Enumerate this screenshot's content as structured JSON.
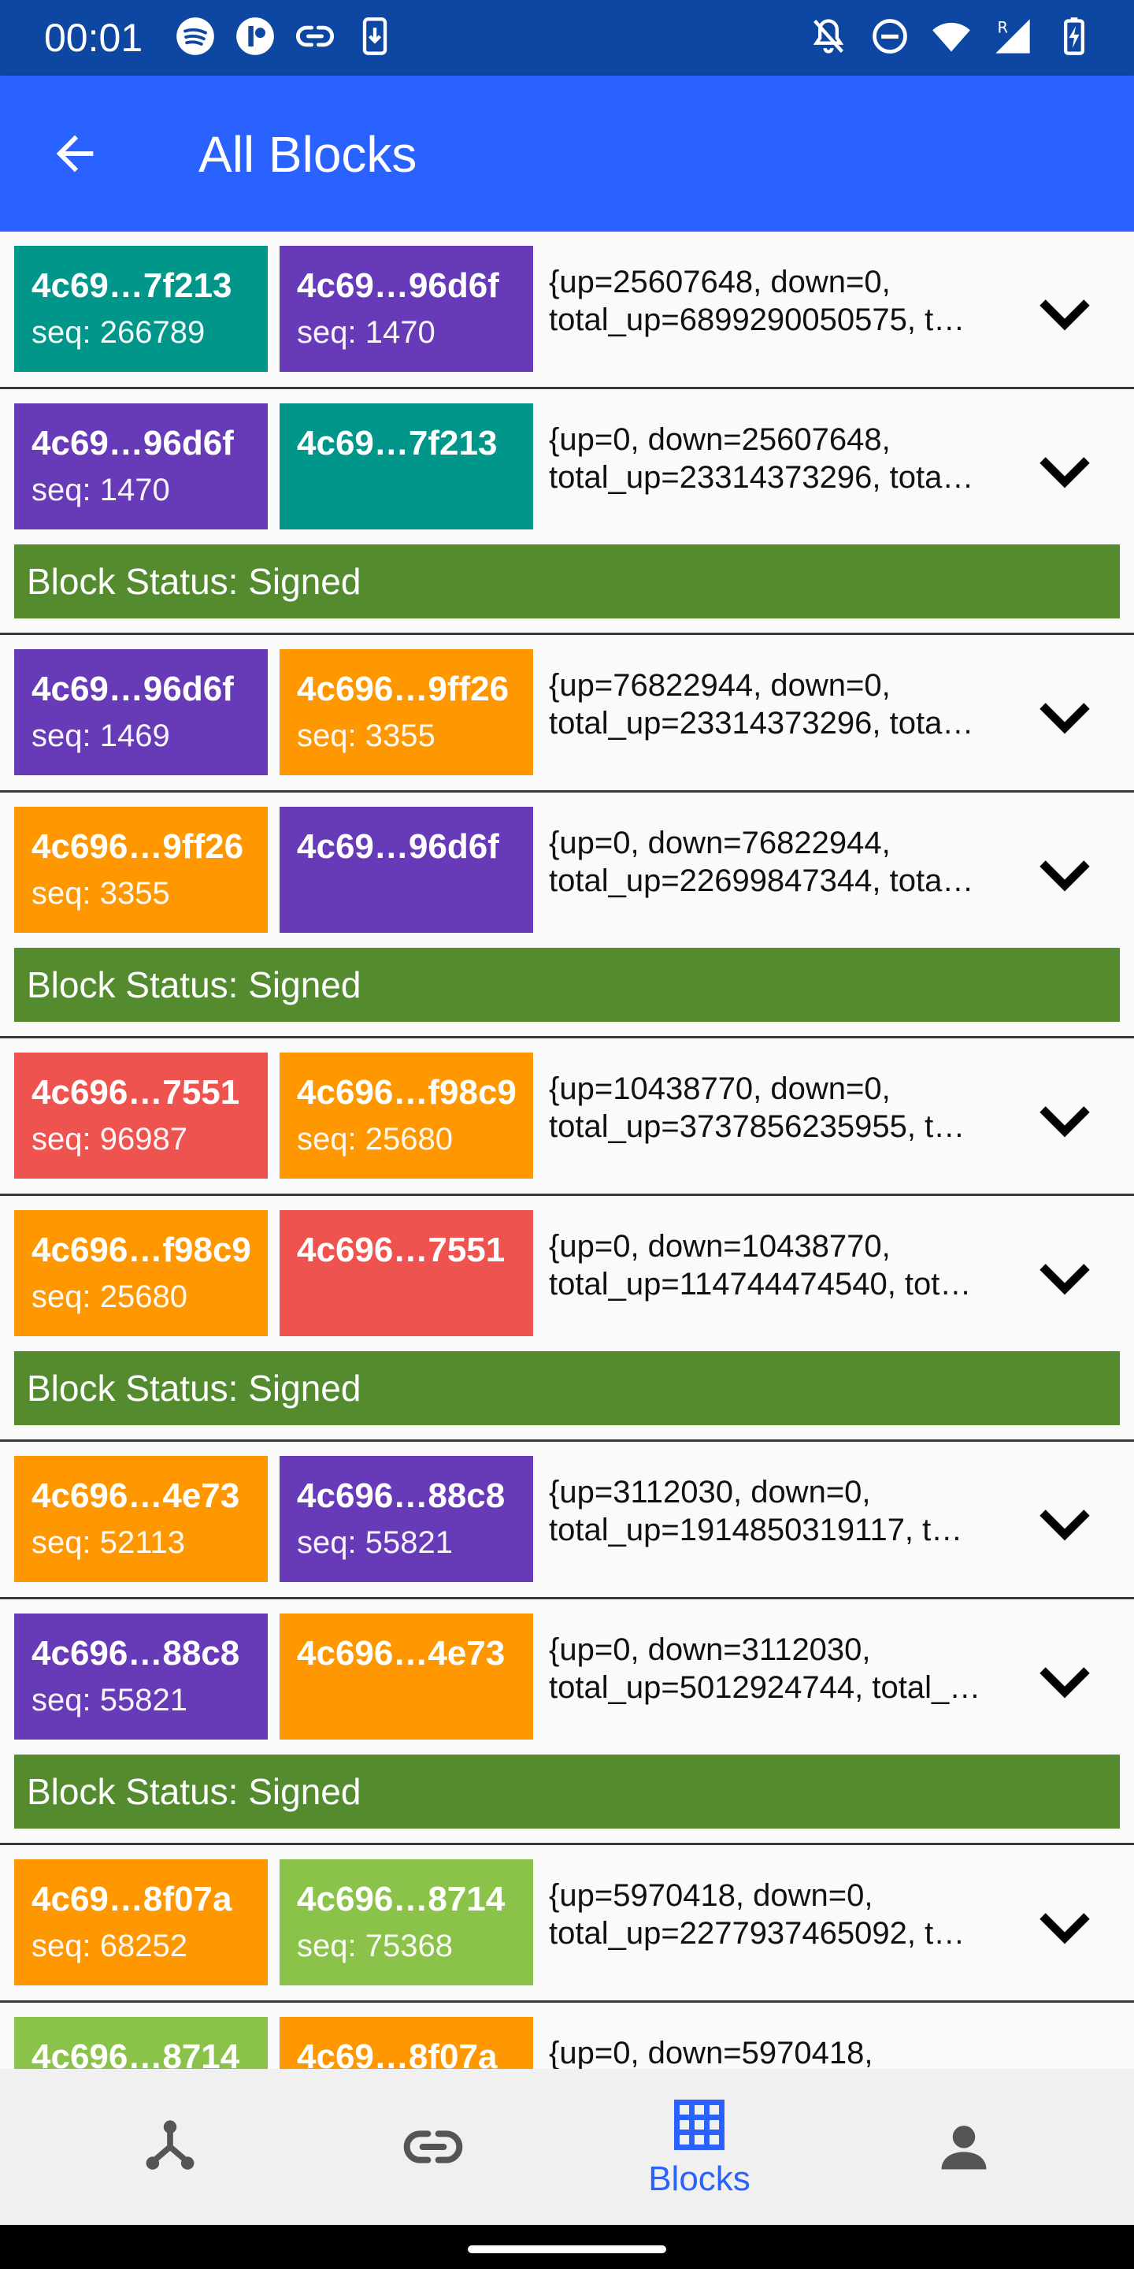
{
  "status_bar": {
    "time": "00:01"
  },
  "app_bar": {
    "title": "All Blocks"
  },
  "colors": {
    "teal": "#00968a",
    "purple": "#673ab7",
    "orange": "#ff9800",
    "red": "#ef5350",
    "green": "#8bc34a",
    "status_green": "#558b2f",
    "app_blue": "#2962ff"
  },
  "blocks": [
    {
      "chip1": {
        "key": "4c69…7f213",
        "seq": "seq: 266789"
      },
      "chip2": {
        "key": "4c69…96d6f",
        "seq": "seq: 1470"
      },
      "line1": "{up=25607648, down=0,",
      "line2": "total_up=6899290050575, t…"
    },
    {
      "chip1": {
        "key": "4c69…96d6f",
        "seq": "seq: 1470"
      },
      "chip2": {
        "key": "4c69…7f213",
        "seq": ""
      },
      "line1": "{up=0, down=25607648,",
      "line2": "total_up=23314373296, tota…",
      "status": "Block Status: Signed"
    },
    {
      "chip1": {
        "key": "4c69…96d6f",
        "seq": "seq: 1469"
      },
      "chip2": {
        "key": "4c696…9ff26",
        "seq": "seq: 3355"
      },
      "line1": "{up=76822944, down=0,",
      "line2": "total_up=23314373296, tota…"
    },
    {
      "chip1": {
        "key": "4c696…9ff26",
        "seq": "seq: 3355"
      },
      "chip2": {
        "key": "4c69…96d6f",
        "seq": ""
      },
      "line1": "{up=0, down=76822944,",
      "line2": "total_up=22699847344, tota…",
      "status": "Block Status: Signed"
    },
    {
      "chip1": {
        "key": "4c696…7551",
        "seq": "seq: 96987"
      },
      "chip2": {
        "key": "4c696…f98c9",
        "seq": "seq: 25680"
      },
      "line1": "{up=10438770, down=0,",
      "line2": "total_up=3737856235955, t…"
    },
    {
      "chip1": {
        "key": "4c696…f98c9",
        "seq": "seq: 25680"
      },
      "chip2": {
        "key": "4c696…7551",
        "seq": ""
      },
      "line1": "{up=0, down=10438770,",
      "line2": "total_up=114744474540, tot…",
      "status": "Block Status: Signed"
    },
    {
      "chip1": {
        "key": "4c696…4e73",
        "seq": "seq: 52113"
      },
      "chip2": {
        "key": "4c696…88c8",
        "seq": "seq: 55821"
      },
      "line1": "{up=3112030, down=0,",
      "line2": "total_up=1914850319117, t…"
    },
    {
      "chip1": {
        "key": "4c696…88c8",
        "seq": "seq: 55821"
      },
      "chip2": {
        "key": "4c696…4e73",
        "seq": ""
      },
      "line1": "{up=0, down=3112030,",
      "line2": "total_up=5012924744, total_…",
      "status": "Block Status: Signed"
    },
    {
      "chip1": {
        "key": "4c69…8f07a",
        "seq": "seq: 68252"
      },
      "chip2": {
        "key": "4c696…8714",
        "seq": "seq: 75368"
      },
      "line1": "{up=5970418, down=0,",
      "line2": "total_up=2277937465092, t…"
    },
    {
      "chip1": {
        "key": "4c696…8714",
        "seq": ""
      },
      "chip2": {
        "key": "4c69…8f07a",
        "seq": ""
      },
      "line1": "{up=0, down=5970418,",
      "line2": ""
    }
  ],
  "bottom_nav": {
    "blocks_label": "Blocks"
  }
}
